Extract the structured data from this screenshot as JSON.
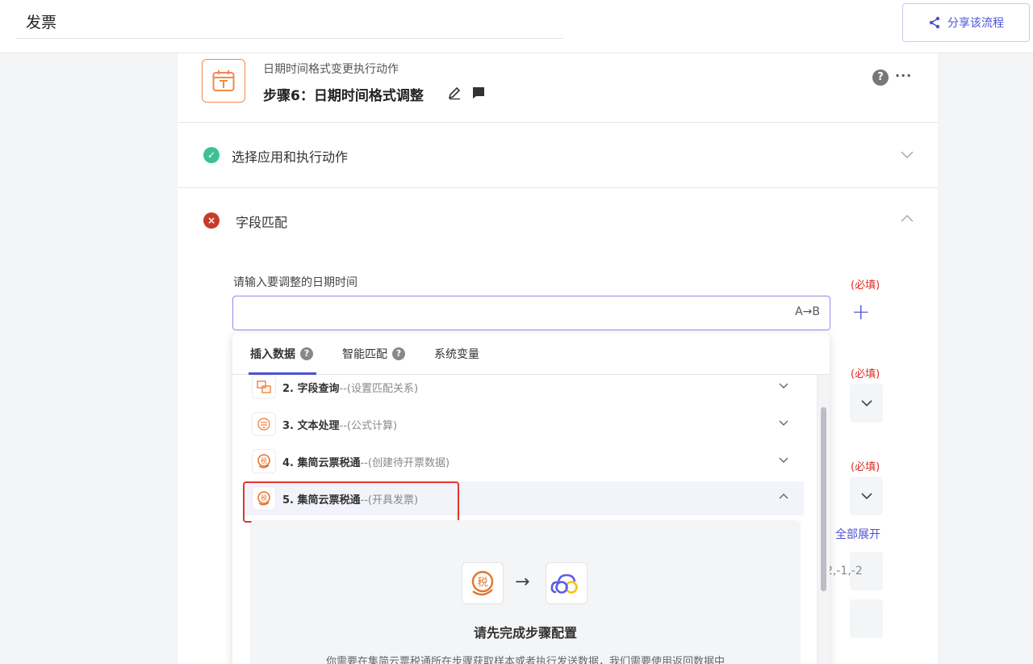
{
  "header": {
    "title": "发票",
    "share_label": "分享该流程"
  },
  "step": {
    "subtitle": "日期时间格式变更执行动作",
    "title": "步骤6：日期时间格式调整",
    "help": "?",
    "more": "···"
  },
  "sections": {
    "select_app": "选择应用和执行动作",
    "field_match": "字段匹配"
  },
  "form": {
    "field_label": "请输入要调整的日期时间",
    "required": "(必填)",
    "input_hint": "A→B",
    "plus": "+",
    "expand_all": "全部展开",
    "partial_value": "2,-1,-2"
  },
  "popup": {
    "tabs": [
      {
        "label": "插入数据",
        "help": "?"
      },
      {
        "label": "智能匹配",
        "help": "?"
      },
      {
        "label": "系统变量"
      }
    ],
    "items": [
      {
        "name": "2. 字段查询",
        "desc": "--(设置匹配关系)",
        "icon": "field-query-icon"
      },
      {
        "name": "3. 文本处理",
        "desc": "--(公式计算)",
        "icon": "text-process-icon"
      },
      {
        "name": "4. 集简云票税通",
        "desc": "--(创建待开票数据)",
        "icon": "tax-app-icon"
      },
      {
        "name": "5. 集简云票税通",
        "desc": "--(开具发票)",
        "icon": "tax-app-icon"
      }
    ],
    "panel": {
      "arrow": "→",
      "title": "请先完成步骤配置",
      "desc": "你需要在集简云票税通所在步骤获取样本或者执行发送数据，我们需要使用返回数据中"
    }
  },
  "colors": {
    "accent": "#4b52d6",
    "orange": "#f08a4b",
    "success": "#3fbf95",
    "error": "#c83a2b",
    "required": "#e02a20"
  }
}
